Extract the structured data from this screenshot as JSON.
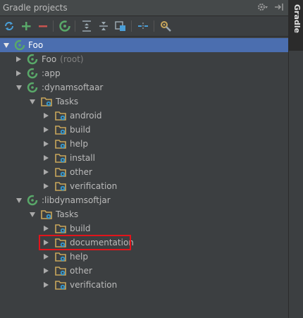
{
  "panel": {
    "title": "Gradle projects",
    "side_tab_label": "Gradle"
  },
  "toolbar": {
    "buttons": [
      "refresh-icon",
      "add-icon",
      "remove-icon",
      "gradle-run-icon",
      "expand-all-icon",
      "collapse-all-icon",
      "link-icon",
      "offline-icon",
      "settings-icon"
    ]
  },
  "tree": {
    "root": {
      "label": "Foo",
      "expanded": true,
      "selected": true
    },
    "foo_root": {
      "label": "Foo",
      "suffix": "(root)"
    },
    "app": {
      "label": ":app"
    },
    "dynamsoftaar": {
      "label": ":dynamsoftaar",
      "tasks_label": "Tasks",
      "tasks": [
        "android",
        "build",
        "help",
        "install",
        "other",
        "verification"
      ]
    },
    "libdynamsoftjar": {
      "label": ":libdynamsoftjar",
      "tasks_label": "Tasks",
      "tasks": [
        "build",
        "documentation",
        "help",
        "other",
        "verification"
      ],
      "highlighted_task": "documentation"
    }
  },
  "colors": {
    "background": "#3c3f41",
    "selection": "#4b6eaf",
    "highlight_box": "#e2141b",
    "gradle_green": "#59a869",
    "folder": "#c8a65b",
    "gear_blue": "#3592c4"
  }
}
